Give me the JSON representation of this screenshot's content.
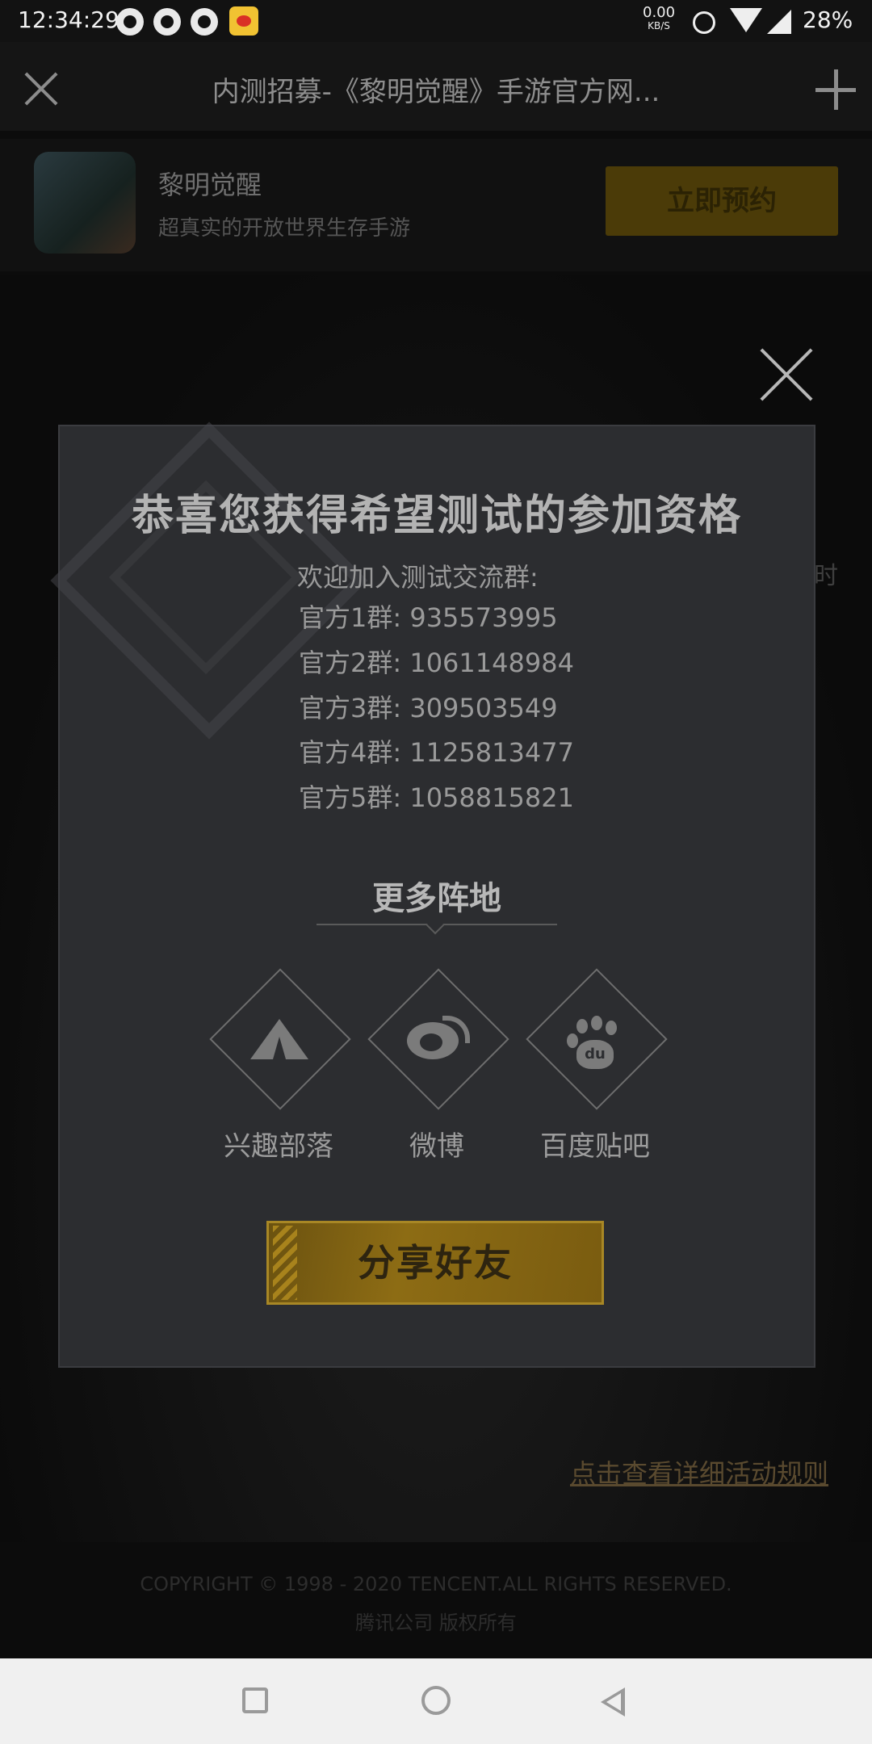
{
  "status_bar": {
    "time": "12:34:29",
    "net_speed_value": "0.00",
    "net_speed_unit": "KB/S",
    "battery": "28%",
    "icons": [
      "app-notification-icon",
      "app-notification-icon",
      "app-notification-icon",
      "weibo-icon",
      "alarm-icon",
      "wifi-icon",
      "signal-icon"
    ]
  },
  "browser": {
    "title": "内测招募-《黎明觉醒》手游官方网..."
  },
  "app_banner": {
    "name": "黎明觉醒",
    "description": "超真实的开放世界生存手游",
    "reserve_label": "立即预约"
  },
  "background_page": {
    "side_text": "时",
    "rules_link": "点击查看详细活动规则",
    "copyright_line1": "COPYRIGHT © 1998 - 2020 TENCENT.ALL RIGHTS RESERVED.",
    "copyright_line2": "腾讯公司 版权所有"
  },
  "modal": {
    "heading": "恭喜您获得希望测试的参加资格",
    "welcome": "欢迎加入测试交流群:",
    "groups": [
      {
        "label": "官方1群:",
        "number": "935573995"
      },
      {
        "label": "官方2群:",
        "number": "1061148984"
      },
      {
        "label": "官方3群:",
        "number": "309503549"
      },
      {
        "label": "官方4群:",
        "number": "1125813477"
      },
      {
        "label": "官方5群:",
        "number": "1058815821"
      }
    ],
    "more_title": "更多阵地",
    "social": [
      {
        "label": "兴趣部落",
        "icon": "tent-icon"
      },
      {
        "label": "微博",
        "icon": "weibo-icon"
      },
      {
        "label": "百度贴吧",
        "icon": "baidu-paw-icon"
      }
    ],
    "baidu_mark": "du",
    "share_label": "分享好友"
  },
  "colors": {
    "modal_bg": "#2c2d30",
    "share_button": "#8d6c14",
    "reserve_button": "#4b3b08"
  }
}
